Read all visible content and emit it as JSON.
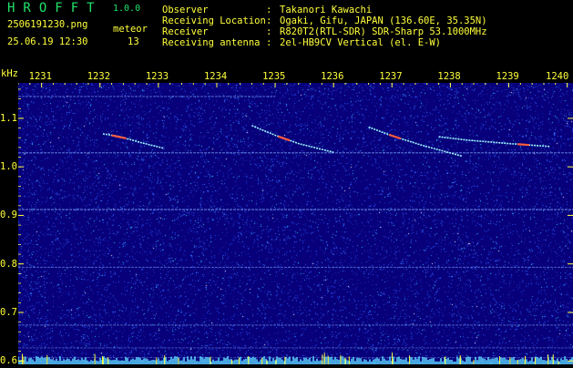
{
  "header": {
    "app_name": "HROFFT",
    "version": "1.0.0",
    "filename": "2506191230.png",
    "datetime": "25.06.19 12:30",
    "meteor_label": "meteor",
    "meteor_count": "13",
    "fields": [
      {
        "label": "Observer",
        "value": "Takanori Kawachi"
      },
      {
        "label": "Receiving Location",
        "value": "Ogaki, Gifu, JAPAN (136.60E, 35.35N)"
      },
      {
        "label": "Receiver",
        "value": "R820T2(RTL-SDR) SDR-Sharp 53.1000MHz"
      },
      {
        "label": "Receiving antenna",
        "value": "2el-HB9CV Vertical (el. E-W)"
      }
    ],
    "colon": ":"
  },
  "chart_data": {
    "type": "heatmap",
    "ylabel": "kHz",
    "x_ticks": [
      "1231",
      "1232",
      "1233",
      "1234",
      "1235",
      "1236",
      "1237",
      "1238",
      "1239",
      "1240"
    ],
    "x_range": [
      1230.6,
      1240.1
    ],
    "y_ticks": [
      "1.1",
      "1.0",
      "0.9",
      "0.8",
      "0.7",
      "0.6"
    ],
    "y_range": [
      0.593,
      1.173
    ],
    "colors": {
      "background": "#07007a",
      "noise": [
        "#1b2fb8",
        "#2f59ff",
        "#3c8cff",
        "#2bd2ff",
        "#ffffff"
      ],
      "tick": "#ffff3c",
      "carrier": "#7fa8ff",
      "meteor": "#9cf5ff",
      "meteor_hot": "#ff5a3c",
      "floor": "#5fdcff"
    },
    "carriers": [
      {
        "y": 1.145,
        "x0": 1230.6,
        "x1": 1235.0,
        "strength": 0.55
      },
      {
        "y": 1.029,
        "x0": 1230.6,
        "x1": 1240.1,
        "strength": 0.6
      },
      {
        "y": 0.912,
        "x0": 1230.6,
        "x1": 1240.1,
        "strength": 0.75
      },
      {
        "y": 0.793,
        "x0": 1230.6,
        "x1": 1240.1,
        "strength": 0.5
      },
      {
        "y": 0.674,
        "x0": 1230.6,
        "x1": 1240.1,
        "strength": 0.45
      },
      {
        "y": 0.627,
        "x0": 1230.6,
        "x1": 1240.1,
        "strength": 0.35
      },
      {
        "y": 0.607,
        "x0": 1230.6,
        "x1": 1240.1,
        "strength": 0.35
      }
    ],
    "meteors": [
      {
        "points": [
          [
            1232.05,
            1.068
          ],
          [
            1232.35,
            1.062
          ],
          [
            1232.7,
            1.05
          ],
          [
            1233.1,
            1.038
          ]
        ],
        "hot": [
          1232.2,
          1232.45
        ]
      },
      {
        "points": [
          [
            1234.6,
            1.085
          ],
          [
            1235.0,
            1.065
          ],
          [
            1235.4,
            1.048
          ],
          [
            1236.0,
            1.03
          ]
        ],
        "hot": [
          1235.05,
          1235.25
        ]
      },
      {
        "points": [
          [
            1236.6,
            1.082
          ],
          [
            1237.0,
            1.064
          ],
          [
            1237.5,
            1.045
          ],
          [
            1238.2,
            1.022
          ]
        ],
        "hot": [
          1236.95,
          1237.15
        ]
      },
      {
        "points": [
          [
            1237.8,
            1.062
          ],
          [
            1238.3,
            1.055
          ],
          [
            1239.0,
            1.048
          ],
          [
            1239.7,
            1.042
          ]
        ],
        "hot": [
          1239.15,
          1239.35
        ]
      }
    ]
  }
}
